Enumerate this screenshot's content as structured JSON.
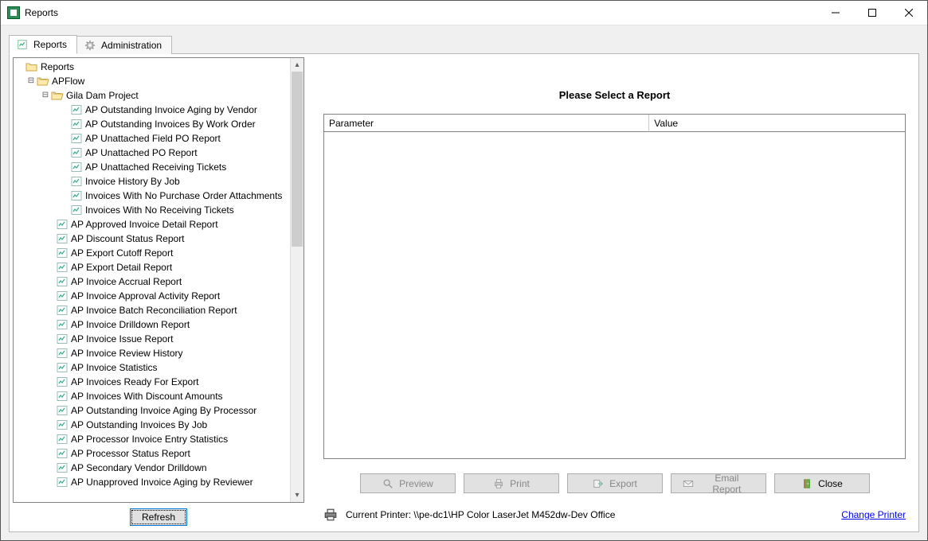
{
  "window": {
    "title": "Reports"
  },
  "tabs": [
    {
      "label": "Reports",
      "active": true
    },
    {
      "label": "Administration",
      "active": false
    }
  ],
  "tree": {
    "root_label": "Reports",
    "apflow_label": "APFlow",
    "project_label": "Gila Dam Project",
    "project_reports": [
      "AP Outstanding Invoice Aging by Vendor",
      "AP Outstanding Invoices By Work Order",
      "AP Unattached Field PO Report",
      "AP Unattached PO Report",
      "AP Unattached Receiving Tickets",
      "Invoice History By Job",
      "Invoices With No Purchase Order Attachments",
      "Invoices With No Receiving Tickets"
    ],
    "apflow_reports": [
      "AP Approved Invoice Detail Report",
      "AP Discount Status Report",
      "AP Export Cutoff Report",
      "AP Export Detail Report",
      "AP Invoice Accrual Report",
      "AP Invoice Approval Activity Report",
      "AP Invoice Batch Reconciliation Report",
      "AP Invoice Drilldown Report",
      "AP Invoice Issue Report",
      "AP Invoice Review History",
      "AP Invoice Statistics",
      "AP Invoices Ready For Export",
      "AP Invoices With Discount Amounts",
      "AP Outstanding Invoice Aging By Processor",
      "AP Outstanding Invoices By Job",
      "AP Processor Invoice Entry Statistics",
      "AP Processor Status Report",
      "AP Secondary Vendor Drilldown",
      "AP Unapproved Invoice Aging by Reviewer"
    ]
  },
  "buttons": {
    "refresh": "Refresh",
    "preview": "Preview",
    "print": "Print",
    "export": "Export",
    "email": "Email Report",
    "close": "Close"
  },
  "right": {
    "prompt": "Please Select a Report",
    "col_parameter": "Parameter",
    "col_value": "Value"
  },
  "footer": {
    "current_printer_prefix": "Current Printer:  ",
    "current_printer_value": "\\\\pe-dc1\\HP Color LaserJet M452dw-Dev Office",
    "change_printer": "Change Printer"
  }
}
